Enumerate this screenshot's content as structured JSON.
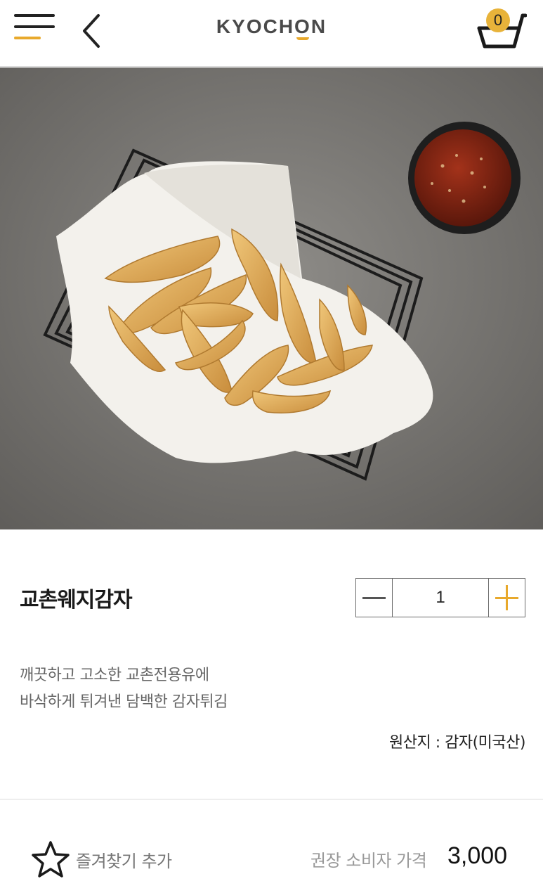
{
  "header": {
    "logo_before": "KYOCH",
    "logo_accent": "O",
    "logo_after": "N",
    "cart_count": "0",
    "accent_color": "#e8a92c"
  },
  "product": {
    "image_icon": "potato-wedges-photo",
    "name": "교촌웨지감자",
    "quantity": "1",
    "description_line1": "깨끗하고 고소한 교촌전용유에",
    "description_line2": "바삭하게 튀겨낸 담백한 감자튀김",
    "origin": "원산지 : 감자(미국산)"
  },
  "footer": {
    "favorite_label": "즐겨찾기 추가",
    "price_label": "권장 소비자 가격",
    "price": "3,000"
  }
}
